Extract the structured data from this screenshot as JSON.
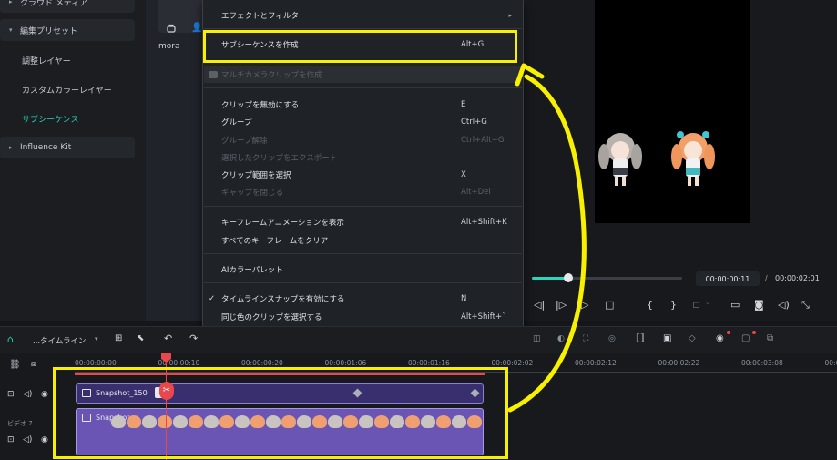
{
  "sidebar": {
    "items": [
      {
        "label": "クラウド メディア",
        "kind": "group-partial"
      },
      {
        "label": "編集プリセット",
        "kind": "group"
      },
      {
        "label": "調整レイヤー",
        "kind": "child"
      },
      {
        "label": "カスタムカラーレイヤー",
        "kind": "child"
      },
      {
        "label": "サブシーケンス",
        "kind": "child-active"
      },
      {
        "label": "Influence Kit",
        "kind": "group"
      }
    ]
  },
  "media": {
    "item_label": "mora"
  },
  "context_menu": {
    "items": [
      {
        "label": "エフェクトとフィルター",
        "shortcut": "",
        "submenu_arrow": "▸"
      },
      {
        "label": "サブシーケンスを作成",
        "shortcut": "Alt+G"
      },
      {
        "label": "マルチカメラクリップを作成",
        "shortcut": ""
      },
      {
        "label": "クリップを無効にする",
        "shortcut": "E"
      },
      {
        "label": "グループ",
        "shortcut": "Ctrl+G"
      },
      {
        "label": "グループ解除",
        "shortcut": "Ctrl+Alt+G"
      },
      {
        "label": "選択したクリップをエクスポート",
        "shortcut": ""
      },
      {
        "label": "クリップ範囲を選択",
        "shortcut": "X"
      },
      {
        "label": "ギャップを閉じる",
        "shortcut": "Alt+Del"
      },
      {
        "label": "キーフレームアニメーションを表示",
        "shortcut": "Alt+Shift+K"
      },
      {
        "label": "すべてのキーフレームをクリア",
        "shortcut": ""
      },
      {
        "label": "AIカラーパレット",
        "shortcut": ""
      },
      {
        "label": "タイムラインスナップを有効にする",
        "shortcut": "N",
        "check": "✓"
      },
      {
        "label": "同じ色のクリップを選択する",
        "shortcut": "Alt+Shift+`"
      }
    ],
    "swatches": [
      "#c0646c",
      "#c08a5a",
      "#c9a04e",
      "#4f9e86",
      "#3e9fc1",
      "#4a67c9",
      "#7a56c4",
      "#8e9e52",
      "#5a9a5e",
      "#3e8f8a",
      "#b5585a",
      "#a9782e"
    ]
  },
  "preview": {
    "current_time": "00:00:00:11",
    "separator": "/",
    "total_time": "00:00:02:01",
    "progress": 0.24
  },
  "timeline": {
    "name": "...タイムライン",
    "ruler_ticks": [
      "00:00:00:00",
      "00:00:00:10",
      "00:00:00:20",
      "00:00:01:06",
      "00:00:01:16",
      "00:00:02:02",
      "00:00:02:12",
      "00:00:02:22",
      "00:00:03:08",
      "00:00"
    ],
    "tracks": [
      {
        "clip_label": "Snapshot_150"
      },
      {
        "label": "ビデオ 7",
        "clip_label": "Snapshot"
      }
    ]
  },
  "colors": {
    "accent": "#2ad6bd",
    "highlight": "#f7f000",
    "playhead": "#e8474c",
    "clip_purple": "#6a55b5"
  }
}
